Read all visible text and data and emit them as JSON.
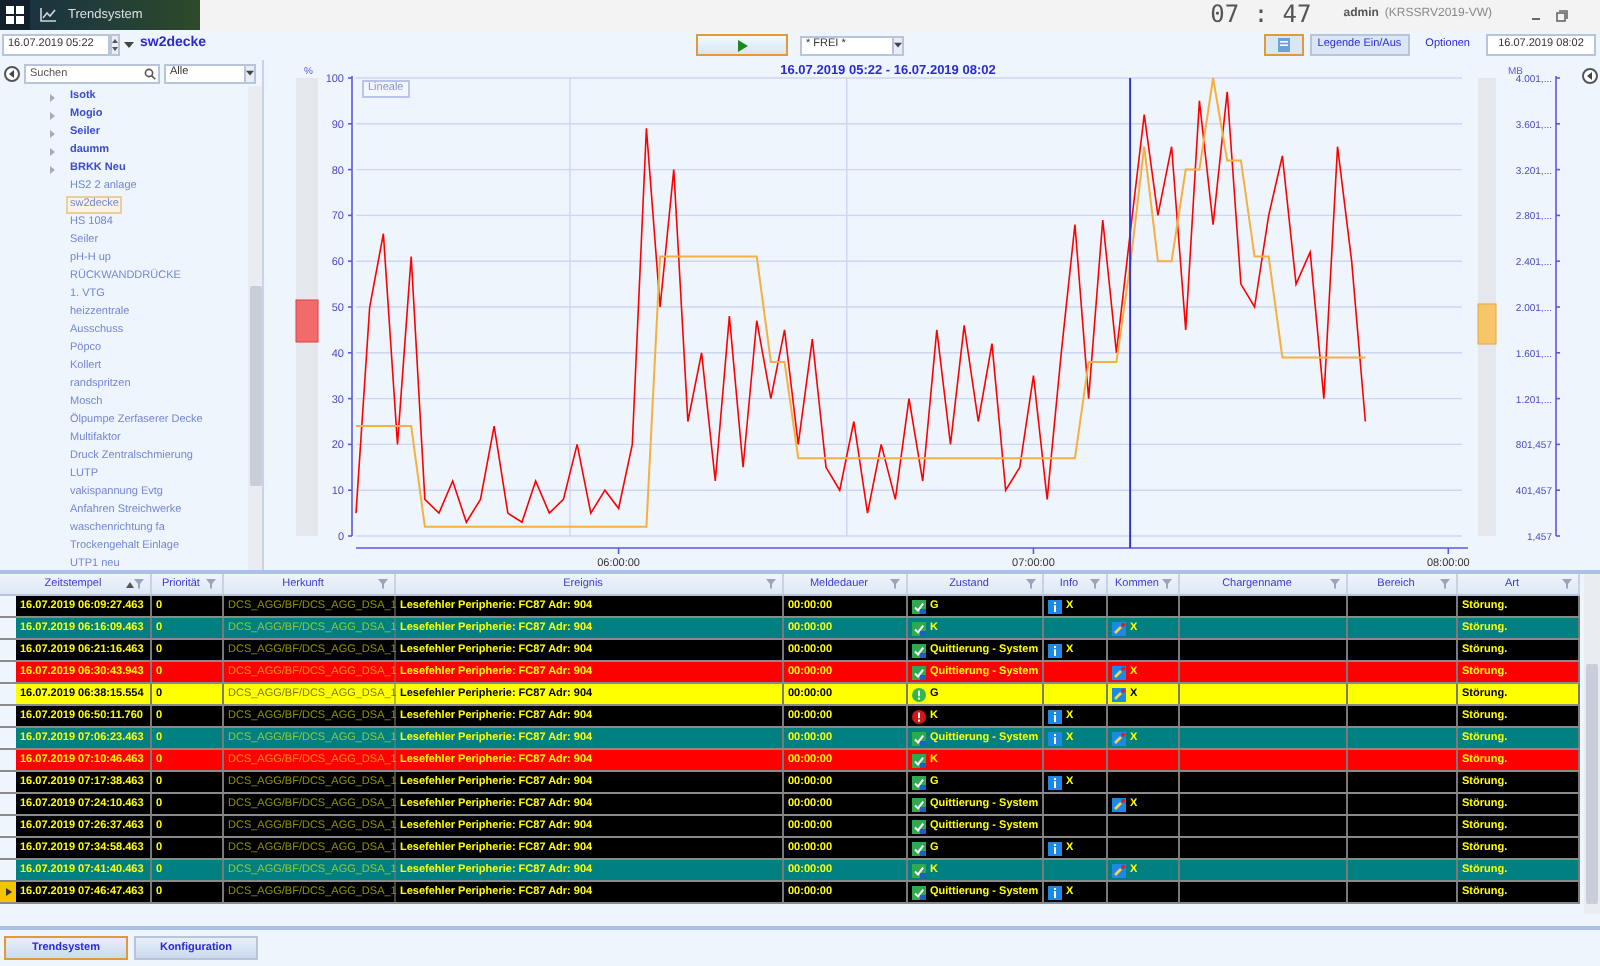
{
  "app_tab": {
    "title": "Trendsystem"
  },
  "clock": "07 : 47",
  "user": {
    "name": "admin",
    "host": "(KRSSRV2019-VW)"
  },
  "toolbar": {
    "start_date": "16.07.2019 05:22",
    "trend_name": "sw2decke",
    "filter": "* FREI *",
    "legend_button": "Legende Ein/Aus",
    "options_link": "Optionen",
    "end_date": "16.07.2019 08:02"
  },
  "sidebar": {
    "search": {
      "placeholder": "Suchen"
    },
    "filter": "Alle",
    "items": [
      {
        "label": "Isotk",
        "kind": "group",
        "selected": false
      },
      {
        "label": "Mogio",
        "kind": "group",
        "selected": false
      },
      {
        "label": "Seiler",
        "kind": "group",
        "selected": false
      },
      {
        "label": "daumm",
        "kind": "group",
        "selected": false
      },
      {
        "label": "BRKK Neu",
        "kind": "group",
        "selected": false
      },
      {
        "label": "HS2 2 anlage",
        "kind": "leaf",
        "selected": false
      },
      {
        "label": "sw2decke",
        "kind": "leaf",
        "selected": true
      },
      {
        "label": "HS 1084",
        "kind": "leaf",
        "selected": false
      },
      {
        "label": "Seiler",
        "kind": "leaf",
        "selected": false
      },
      {
        "label": "pH-H up",
        "kind": "leaf",
        "selected": false
      },
      {
        "label": "RÜCKWANDDRÜCKE",
        "kind": "leaf",
        "selected": false
      },
      {
        "label": "1. VTG",
        "kind": "leaf",
        "selected": false
      },
      {
        "label": "heizzentrale",
        "kind": "leaf",
        "selected": false
      },
      {
        "label": "Ausschuss",
        "kind": "leaf",
        "selected": false
      },
      {
        "label": "Pöpco",
        "kind": "leaf",
        "selected": false
      },
      {
        "label": "Kollert",
        "kind": "leaf",
        "selected": false
      },
      {
        "label": "randspritzen",
        "kind": "leaf",
        "selected": false
      },
      {
        "label": "Mosch",
        "kind": "leaf",
        "selected": false
      },
      {
        "label": "Ölpumpe Zerfaserer Decke",
        "kind": "leaf",
        "selected": false
      },
      {
        "label": "Multifaktor",
        "kind": "leaf",
        "selected": false
      },
      {
        "label": "Druck Zentralschmierung",
        "kind": "leaf",
        "selected": false
      },
      {
        "label": "LUTP",
        "kind": "leaf",
        "selected": false
      },
      {
        "label": "vakispannung Evtg",
        "kind": "leaf",
        "selected": false
      },
      {
        "label": "Anfahren Streichwerke",
        "kind": "leaf",
        "selected": false
      },
      {
        "label": "waschenrichtung fa",
        "kind": "leaf",
        "selected": false
      },
      {
        "label": "Trockengehalt Einlage",
        "kind": "leaf",
        "selected": false
      },
      {
        "label": "UTP1 neu",
        "kind": "leaf",
        "selected": false
      }
    ]
  },
  "chart": {
    "ruler_button": "Lineale",
    "right_axis": {
      "label": "MB",
      "ticks": [
        "4.001,...",
        "3.601,...",
        "3.201,...",
        "2.801,...",
        "2.401,...",
        "2.001,...",
        "1.601,...",
        "1.201,...",
        "801,457",
        "401,457",
        "1,457"
      ]
    },
    "chart_data": {
      "type": "line",
      "title": "16.07.2019 05:22 - 16.07.2019 08:02",
      "ylabel": "%",
      "xlim": [
        5.367,
        8.033
      ],
      "ylim": [
        0,
        100
      ],
      "yticks": [
        0,
        10,
        20,
        30,
        40,
        50,
        60,
        70,
        80,
        90,
        100
      ],
      "xticks": [
        {
          "value": 6,
          "label": "06:00:00"
        },
        {
          "value": 7,
          "label": "07:00:00"
        },
        {
          "value": 8,
          "label": "08:00:00"
        }
      ],
      "x": [
        5.367,
        5.4,
        5.433,
        5.467,
        5.5,
        5.533,
        5.567,
        5.6,
        5.633,
        5.667,
        5.7,
        5.733,
        5.767,
        5.8,
        5.833,
        5.867,
        5.9,
        5.933,
        5.967,
        6.0,
        6.033,
        6.067,
        6.1,
        6.133,
        6.167,
        6.2,
        6.233,
        6.267,
        6.3,
        6.333,
        6.367,
        6.4,
        6.433,
        6.467,
        6.5,
        6.533,
        6.567,
        6.6,
        6.633,
        6.667,
        6.7,
        6.733,
        6.767,
        6.8,
        6.833,
        6.867,
        6.9,
        6.933,
        6.967,
        7.0,
        7.033,
        7.067,
        7.1,
        7.133,
        7.167,
        7.2,
        7.233,
        7.267,
        7.3,
        7.333,
        7.367,
        7.4,
        7.433,
        7.467,
        7.5,
        7.533,
        7.567,
        7.6,
        7.633,
        7.667,
        7.7,
        7.733,
        7.767,
        7.8
      ],
      "series": [
        {
          "color": "#ff0000",
          "values": [
            5,
            50,
            66,
            20,
            61,
            8,
            5,
            12,
            3,
            8,
            24,
            5,
            3,
            12,
            5,
            8,
            20,
            5,
            10,
            6,
            20,
            89,
            50,
            80,
            25,
            40,
            12,
            48,
            15,
            47,
            30,
            45,
            20,
            43,
            15,
            10,
            25,
            5,
            20,
            8,
            30,
            12,
            45,
            20,
            46,
            25,
            42,
            10,
            15,
            35,
            8,
            40,
            68,
            30,
            69,
            40,
            66,
            92,
            70,
            85,
            45,
            95,
            68,
            97,
            55,
            50,
            70,
            83,
            55,
            62,
            30,
            85,
            60,
            25
          ]
        },
        {
          "color": "#f5b041",
          "values": [
            24,
            24,
            24,
            24,
            24,
            2,
            2,
            2,
            2,
            2,
            2,
            2,
            2,
            2,
            2,
            2,
            2,
            2,
            2,
            2,
            2,
            2,
            61,
            61,
            61,
            61,
            61,
            61,
            61,
            61,
            38,
            38,
            17,
            17,
            17,
            17,
            17,
            17,
            17,
            17,
            17,
            17,
            17,
            17,
            17,
            17,
            17,
            17,
            17,
            17,
            17,
            17,
            17,
            38,
            38,
            38,
            59,
            85,
            60,
            60,
            80,
            80,
            100,
            82,
            82,
            61,
            61,
            39,
            39,
            39,
            39,
            39,
            39,
            39
          ]
        }
      ],
      "grid": true,
      "ref_lines": [
        {
          "axis": "x",
          "value": 7.233
        }
      ]
    }
  },
  "table": {
    "columns": [
      {
        "label": "Zeitstempel",
        "sorted": true
      },
      {
        "label": "Priorität",
        "sorted": false
      },
      {
        "label": "Herkunft",
        "sorted": false
      },
      {
        "label": "Ereignis",
        "sorted": false
      },
      {
        "label": "Meldedauer",
        "sorted": false
      },
      {
        "label": "Zustand",
        "sorted": false
      },
      {
        "label": "Info",
        "sorted": false
      },
      {
        "label": "Kommen",
        "sorted": false
      },
      {
        "label": "Chargenname",
        "sorted": false
      },
      {
        "label": "Bereich",
        "sorted": false
      },
      {
        "label": "Art",
        "sorted": false
      }
    ],
    "rows": [
      {
        "time": "16.07.2019 06:09:27.463",
        "priority": "0",
        "origin": "DCS_AGG/BF/DCS_AGG_DSA_1",
        "event": "Lesefehler Peripherie: FC87 Adr: 904",
        "duration": "00:00:00",
        "kind": "ack",
        "status": "G",
        "info": "X",
        "type": "Störung.",
        "color": "#000000",
        "selected": false
      },
      {
        "time": "16.07.2019 06:16:09.463",
        "priority": "0",
        "origin": "DCS_AGG/BF/DCS_AGG_DSA_1",
        "event": "Lesefehler Peripherie: FC87 Adr: 904",
        "duration": "00:00:00",
        "kind": "ack",
        "status": "K",
        "comment": "X",
        "type": "Störung.",
        "color": "#008080",
        "selected": false
      },
      {
        "time": "16.07.2019 06:21:16.463",
        "priority": "0",
        "origin": "DCS_AGG/BF/DCS_AGG_DSA_1",
        "event": "Lesefehler Peripherie: FC87 Adr: 904",
        "duration": "00:00:00",
        "kind": "ack",
        "status": "Quittierung - System",
        "info": "X",
        "type": "Störung.",
        "color": "#000000",
        "selected": false
      },
      {
        "time": "16.07.2019 06:30:43.943",
        "priority": "0",
        "origin": "DCS_AGG/BF/DCS_AGG_DSA_1",
        "event": "Lesefehler Peripherie: FC87 Adr: 904",
        "duration": "00:00:00",
        "kind": "ack",
        "status": "Quittierung - System",
        "comment": "X",
        "type": "Störung.",
        "color": "#ff0000",
        "selected": false
      },
      {
        "time": "16.07.2019 06:38:15.554",
        "priority": "0",
        "origin": "DCS_AGG/BF/DCS_AGG_DSA_1",
        "event": "Lesefehler Peripherie: FC87 Adr: 904",
        "duration": "00:00:00",
        "kind": "ok",
        "status": "G",
        "comment": "X",
        "type": "Störung.",
        "color": "#ffff00",
        "selected": false
      },
      {
        "time": "16.07.2019 06:50:11.760",
        "priority": "0",
        "origin": "DCS_AGG/BF/DCS_AGG_DSA_1",
        "event": "Lesefehler Peripherie: FC87 Adr: 904",
        "duration": "00:00:00",
        "kind": "alarm",
        "status": "K",
        "info": "X",
        "type": "Störung.",
        "color": "#000000",
        "selected": false
      },
      {
        "time": "16.07.2019 07:06:23.463",
        "priority": "0",
        "origin": "DCS_AGG/BF/DCS_AGG_DSA_1",
        "event": "Lesefehler Peripherie: FC87 Adr: 904",
        "duration": "00:00:00",
        "kind": "ack",
        "status": "Quittierung - System",
        "info": "X",
        "comment": "X",
        "type": "Störung.",
        "color": "#008080",
        "selected": false
      },
      {
        "time": "16.07.2019 07:10:46.463",
        "priority": "0",
        "origin": "DCS_AGG/BF/DCS_AGG_DSA_1",
        "event": "Lesefehler Peripherie: FC87 Adr: 904",
        "duration": "00:00:00",
        "kind": "ack",
        "status": "K",
        "type": "Störung.",
        "color": "#ff0000",
        "selected": false
      },
      {
        "time": "16.07.2019 07:17:38.463",
        "priority": "0",
        "origin": "DCS_AGG/BF/DCS_AGG_DSA_1",
        "event": "Lesefehler Peripherie: FC87 Adr: 904",
        "duration": "00:00:00",
        "kind": "ack",
        "status": "G",
        "info": "X",
        "type": "Störung.",
        "color": "#000000",
        "selected": false
      },
      {
        "time": "16.07.2019 07:24:10.463",
        "priority": "0",
        "origin": "DCS_AGG/BF/DCS_AGG_DSA_1",
        "event": "Lesefehler Peripherie: FC87 Adr: 904",
        "duration": "00:00:00",
        "kind": "ack",
        "status": "Quittierung - System",
        "comment": "X",
        "type": "Störung.",
        "color": "#000000",
        "selected": false
      },
      {
        "time": "16.07.2019 07:26:37.463",
        "priority": "0",
        "origin": "DCS_AGG/BF/DCS_AGG_DSA_1",
        "event": "Lesefehler Peripherie: FC87 Adr: 904",
        "duration": "00:00:00",
        "kind": "ack",
        "status": "Quittierung - System",
        "type": "Störung.",
        "color": "#000000",
        "selected": false
      },
      {
        "time": "16.07.2019 07:34:58.463",
        "priority": "0",
        "origin": "DCS_AGG/BF/DCS_AGG_DSA_1",
        "event": "Lesefehler Peripherie: FC87 Adr: 904",
        "duration": "00:00:00",
        "kind": "ack",
        "status": "G",
        "info": "X",
        "type": "Störung.",
        "color": "#000000",
        "selected": false
      },
      {
        "time": "16.07.2019 07:41:40.463",
        "priority": "0",
        "origin": "DCS_AGG/BF/DCS_AGG_DSA_1",
        "event": "Lesefehler Peripherie: FC87 Adr: 904",
        "duration": "00:00:00",
        "kind": "ack",
        "status": "K",
        "comment": "X",
        "type": "Störung.",
        "color": "#008080",
        "selected": false
      },
      {
        "time": "16.07.2019 07:46:47.463",
        "priority": "0",
        "origin": "DCS_AGG/BF/DCS_AGG_DSA_1",
        "event": "Lesefehler Peripherie: FC87 Adr: 904",
        "duration": "00:00:00",
        "kind": "ack",
        "status": "Quittierung - System",
        "info": "X",
        "type": "Störung.",
        "color": "#000000",
        "selected": true
      }
    ]
  },
  "bottom_tabs": [
    {
      "label": "Trendsystem",
      "selected": true
    },
    {
      "label": "Konfiguration",
      "selected": false
    }
  ]
}
